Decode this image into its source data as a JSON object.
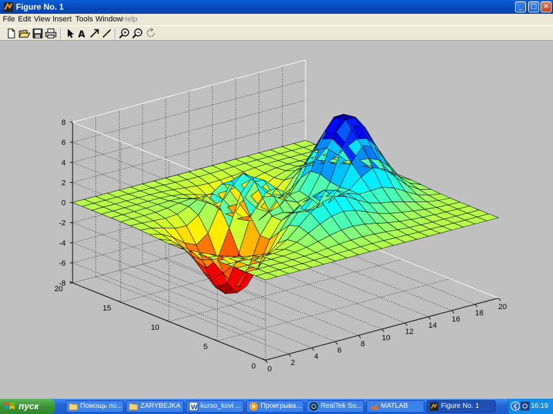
{
  "window": {
    "title": "Figure No. 1"
  },
  "menu": [
    "File",
    "Edit",
    "View",
    "Insert",
    "Tools",
    "Window",
    "Help"
  ],
  "toolbar": [
    "new-file-icon",
    "open-folder-icon",
    "save-icon",
    "print-icon",
    "pointer-icon",
    "text-icon",
    "arrow-icon",
    "line-icon",
    "zoom-in-icon",
    "zoom-out-icon",
    "rotate-icon"
  ],
  "chart_data": {
    "type": "surface",
    "function": "peaks",
    "grid": true,
    "colormap": "jet",
    "x_ticks": [
      "0",
      "2",
      "4",
      "6",
      "8",
      "10",
      "12",
      "14",
      "16",
      "18",
      "20"
    ],
    "y_ticks": [
      "0",
      "5",
      "10",
      "15",
      "20"
    ],
    "z_ticks": [
      "8",
      "6",
      "4",
      "2",
      "0",
      "-2",
      "-4",
      "-6",
      "-8"
    ],
    "xlim": [
      0,
      20
    ],
    "ylim": [
      0,
      20
    ],
    "zlim": [
      -8,
      8
    ],
    "grid_size": [
      20,
      20
    ]
  },
  "taskbar": {
    "start": "пуск",
    "items": [
      {
        "label": "Помощь по...",
        "icon": "folder-icon"
      },
      {
        "label": "ZARYBEJKA",
        "icon": "folder-icon"
      },
      {
        "label": "kurso_kovi ...",
        "icon": "word-icon"
      },
      {
        "label": "Проигрыва...",
        "icon": "media-player-icon"
      },
      {
        "label": "RealTek So...",
        "icon": "audio-icon"
      },
      {
        "label": "MATLAB",
        "icon": "matlab-icon"
      },
      {
        "label": "Figure No. 1",
        "icon": "figure-icon"
      }
    ],
    "clock": "16:19"
  }
}
